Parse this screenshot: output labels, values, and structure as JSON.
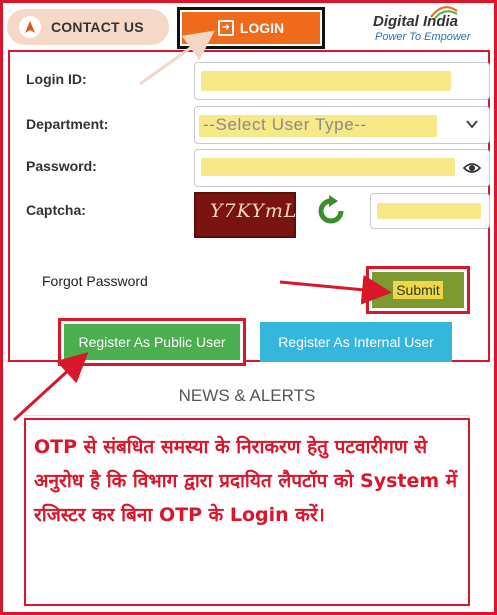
{
  "header": {
    "contact_label": "CONTACT US",
    "login_label": "LOGIN",
    "logo_main": "Digital India",
    "logo_sub": "Power To Empower"
  },
  "form": {
    "login_id_label": "Login ID:",
    "department_label": "Department:",
    "department_value": "--Select User Type--",
    "password_label": "Password:",
    "captcha_label": "Captcha:",
    "captcha_text": "Y7KYmL",
    "forgot_password": "Forgot Password",
    "submit_label": "Submit"
  },
  "register": {
    "public_label": "Register As Public User",
    "internal_label": "Register As Internal User"
  },
  "news": {
    "title": "NEWS & ALERTS",
    "alert_text": "OTP से संबधित समस्या के निराकरण हेतु पटवारीगण से अनुरोध है कि विभाग द्वारा प्रदायित लैपटॉप को System में रजिस्टर कर बिना OTP के Login करें।"
  },
  "colors": {
    "annotation_red": "#d9162b",
    "login_orange": "#ef6a1a",
    "public_green": "#4caf4f",
    "internal_blue": "#35b6dc",
    "highlight_yellow": "#f7e88a"
  }
}
